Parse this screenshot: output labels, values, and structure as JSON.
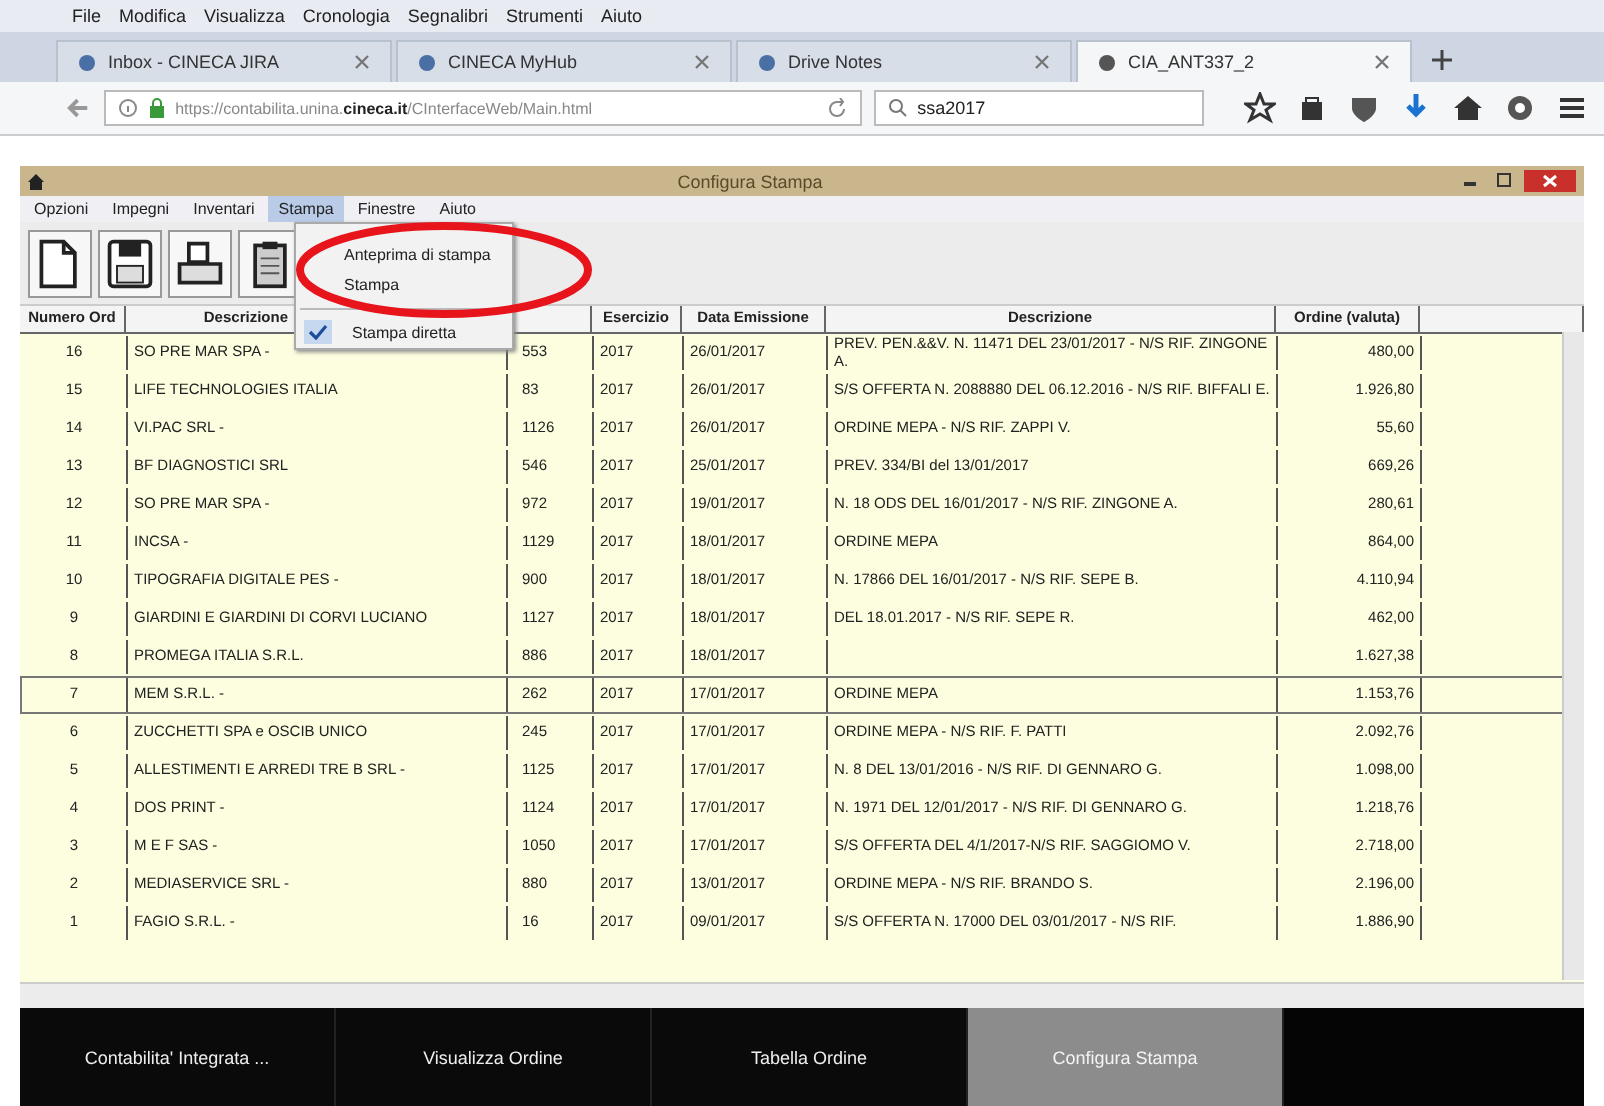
{
  "browser": {
    "menu": [
      "File",
      "Modifica",
      "Visualizza",
      "Cronologia",
      "Segnalibri",
      "Strumenti",
      "Aiuto"
    ],
    "tabs": [
      {
        "label": "Inbox - CINECA JIRA",
        "selected": false
      },
      {
        "label": "CINECA MyHub",
        "selected": false
      },
      {
        "label": "Drive Notes",
        "selected": false
      },
      {
        "label": "CIA_ANT337_2",
        "selected": true
      }
    ],
    "url": "https://contabilita.unina.**cineca.it**/CInterfaceWeb/Main.html",
    "search": "ssa2017"
  },
  "app": {
    "title": "Configura Stampa",
    "menu": [
      {
        "label": "Opzioni",
        "selected": false
      },
      {
        "label": "Impegni",
        "selected": false
      },
      {
        "label": "Inventari",
        "selected": false
      },
      {
        "label": "Stampa",
        "selected": true
      },
      {
        "label": "Finestre",
        "selected": false
      },
      {
        "label": "Aiuto",
        "selected": false
      }
    ],
    "dropdown": [
      {
        "kind": "item",
        "label": "Anteprima di stampa"
      },
      {
        "kind": "item",
        "label": "Stampa"
      },
      {
        "kind": "check",
        "label": "Stampa diretta",
        "checked": true
      }
    ],
    "table": {
      "columns": [
        "Numero Ord",
        "Descrizione",
        null,
        "Esercizio",
        "Data Emissione",
        "Descrizione",
        "Ordine (valuta)"
      ],
      "rows": [
        {
          "cells": [
            "16",
            "SO PRE MAR SPA -",
            "553",
            "2017",
            "26/01/2017",
            "PREV. PEN.&&V. N. 11471 DEL 23/01/2017 - N/S RIF. ZINGONE A.",
            "480,00"
          ],
          "selected": false
        },
        {
          "cells": [
            "15",
            "LIFE TECHNOLOGIES ITALIA",
            "83",
            "2017",
            "26/01/2017",
            "S/S OFFERTA N. 2088880 DEL 06.12.2016 - N/S RIF. BIFFALI E.",
            "1.926,80"
          ],
          "selected": false
        },
        {
          "cells": [
            "14",
            "VI.PAC SRL -",
            "1126",
            "2017",
            "26/01/2017",
            "ORDINE MEPA - N/S RIF. ZAPPI V.",
            "55,60"
          ],
          "selected": false
        },
        {
          "cells": [
            "13",
            "BF DIAGNOSTICI SRL",
            "546",
            "2017",
            "25/01/2017",
            "PREV. 334/BI del 13/01/2017",
            "669,26"
          ],
          "selected": false
        },
        {
          "cells": [
            "12",
            "SO PRE MAR SPA -",
            "972",
            "2017",
            "19/01/2017",
            "N. 18 ODS DEL 16/01/2017 - N/S RIF. ZINGONE A.",
            "280,61"
          ],
          "selected": false
        },
        {
          "cells": [
            "11",
            "INCSA -",
            "1129",
            "2017",
            "18/01/2017",
            "ORDINE MEPA",
            "864,00"
          ],
          "selected": false
        },
        {
          "cells": [
            "10",
            "TIPOGRAFIA DIGITALE PES -",
            "900",
            "2017",
            "18/01/2017",
            "N. 17866 DEL 16/01/2017 - N/S RIF. SEPE B.",
            "4.110,94"
          ],
          "selected": false
        },
        {
          "cells": [
            "9",
            "GIARDINI E GIARDINI DI CORVI LUCIANO",
            "1127",
            "2017",
            "18/01/2017",
            "DEL 18.01.2017 - N/S RIF. SEPE R.",
            "462,00"
          ],
          "selected": false
        },
        {
          "cells": [
            "8",
            "PROMEGA ITALIA S.R.L.",
            "886",
            "2017",
            "18/01/2017",
            null,
            "1.627,38"
          ],
          "selected": false
        },
        {
          "cells": [
            "7",
            "MEM S.R.L. -",
            "262",
            "2017",
            "17/01/2017",
            "ORDINE MEPA",
            "1.153,76"
          ],
          "selected": true
        },
        {
          "cells": [
            "6",
            "ZUCCHETTI SPA e OSCIB UNICO",
            "245",
            "2017",
            "17/01/2017",
            "ORDINE MEPA - N/S RIF. F. PATTI",
            "2.092,76"
          ],
          "selected": false
        },
        {
          "cells": [
            "5",
            "ALLESTIMENTI E ARREDI TRE B SRL -",
            "1125",
            "2017",
            "17/01/2017",
            "N. 8 DEL 13/01/2016 - N/S RIF. DI GENNARO G.",
            "1.098,00"
          ],
          "selected": false
        },
        {
          "cells": [
            "4",
            "DOS PRINT -",
            "1124",
            "2017",
            "17/01/2017",
            "N. 1971 DEL 12/01/2017 - N/S RIF. DI GENNARO G.",
            "1.218,76"
          ],
          "selected": false
        },
        {
          "cells": [
            "3",
            "M E F SAS -",
            "1050",
            "2017",
            "17/01/2017",
            "S/S OFFERTA DEL 4/1/2017-N/S RIF. SAGGIOMO V.",
            "2.718,00"
          ],
          "selected": false
        },
        {
          "cells": [
            "2",
            "MEDIASERVICE SRL -",
            "880",
            "2017",
            "13/01/2017",
            "ORDINE MEPA - N/S RIF. BRANDO S.",
            "2.196,00"
          ],
          "selected": false
        },
        {
          "cells": [
            "1",
            "FAGIO S.R.L. -",
            "16",
            "2017",
            "09/01/2017",
            "S/S OFFERTA N. 17000 DEL 03/01/2017 - N/S RIF.",
            "1.886,90"
          ],
          "selected": false
        }
      ]
    }
  },
  "taskbar": [
    {
      "label": "Contabilita' Integrata ...",
      "selected": false
    },
    {
      "label": "Visualizza Ordine",
      "selected": false
    },
    {
      "label": "Tabella Ordine",
      "selected": false
    },
    {
      "label": "Configura Stampa",
      "selected": true
    }
  ]
}
